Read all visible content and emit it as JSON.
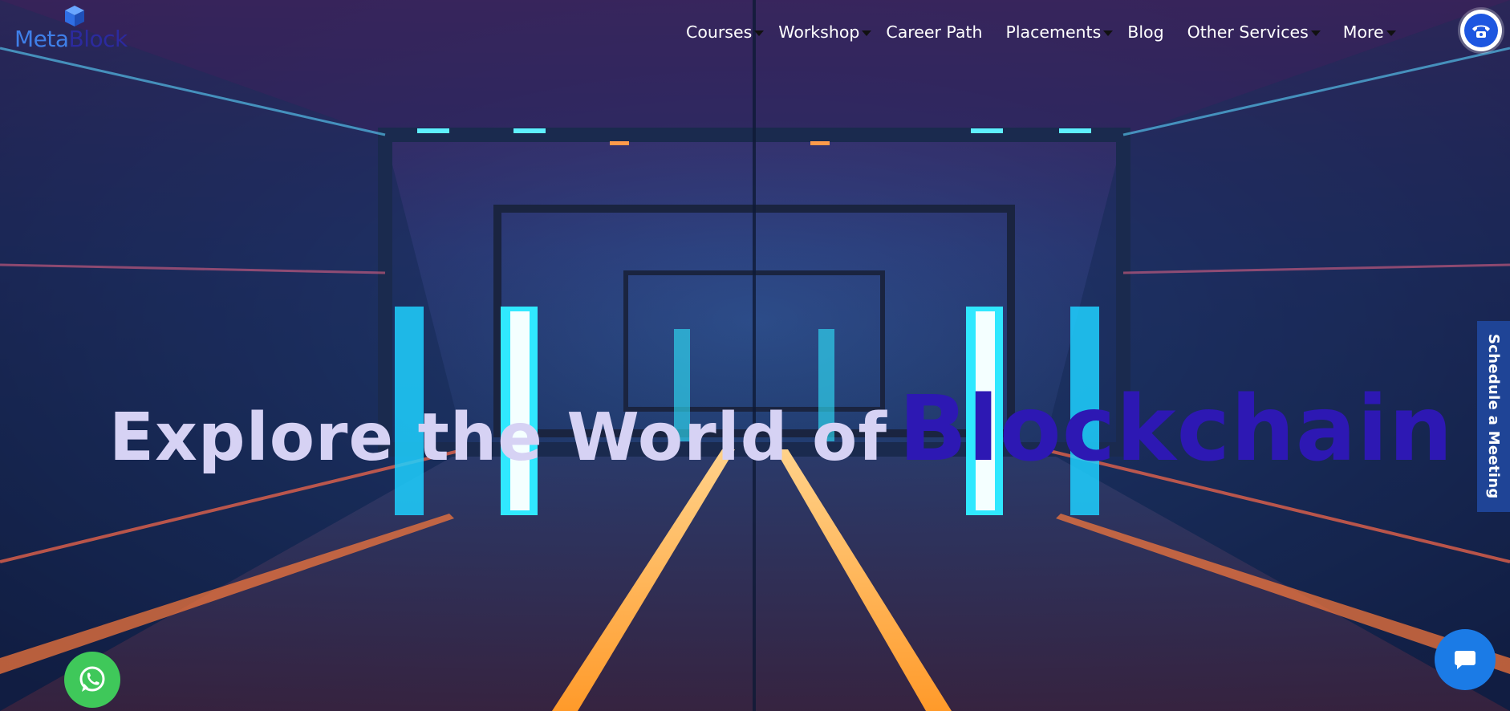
{
  "brand": {
    "part1": "Meta",
    "part2": "Block"
  },
  "nav": {
    "items": [
      {
        "label": "Courses",
        "dropdown": true
      },
      {
        "label": "Workshop",
        "dropdown": true
      },
      {
        "label": "Career Path",
        "dropdown": false
      },
      {
        "label": "Placements",
        "dropdown": true
      },
      {
        "label": "Blog",
        "dropdown": false
      },
      {
        "label": "Other Services",
        "dropdown": true
      },
      {
        "label": "More",
        "dropdown": true
      }
    ]
  },
  "hero": {
    "title_prefix": "Explore the World of",
    "title_highlight": "Blockchain"
  },
  "side_tab": {
    "label": "Schedule a Meeting"
  },
  "icons": {
    "call": "phone-call-icon",
    "whatsapp": "whatsapp-icon",
    "chat": "chat-bubble-icon",
    "logo": "cube-icon"
  },
  "colors": {
    "brand_blue": "#3f7fe8",
    "brand_dark": "#2c2a9e",
    "hero_highlight": "#2d18b3",
    "whatsapp_green": "#3fc85a",
    "chat_blue": "#1b7be6",
    "tab_blue": "#1f4496"
  }
}
